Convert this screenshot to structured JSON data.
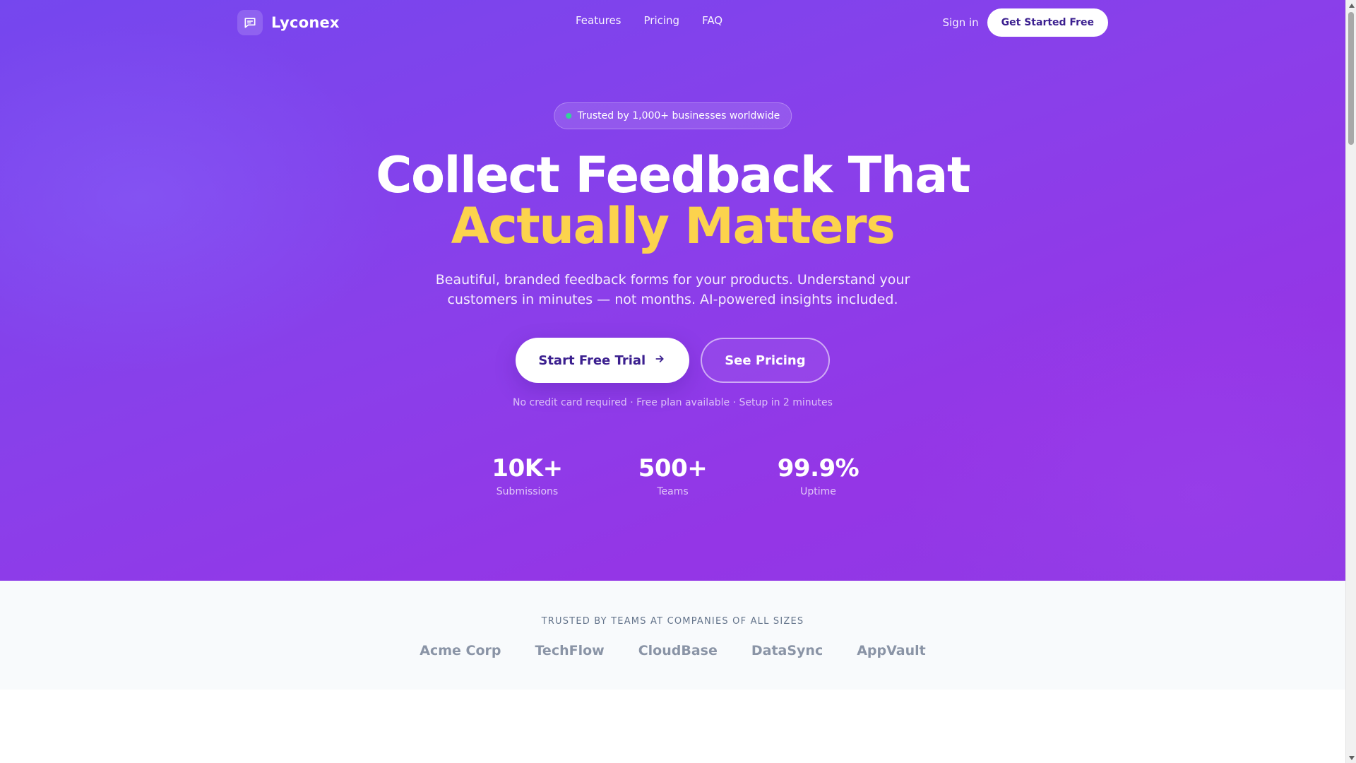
{
  "nav": {
    "brand": "Lyconex",
    "links": [
      "Features",
      "Pricing",
      "FAQ"
    ],
    "sign_in": "Sign in",
    "cta": "Get Started Free"
  },
  "hero": {
    "badge": "Trusted by 1,000+ businesses worldwide",
    "headline_line1": "Collect Feedback That",
    "headline_line2": "Actually Matters",
    "subhead": "Beautiful, branded feedback forms for your products. Understand your customers in minutes — not months. AI-powered insights included.",
    "primary_cta": "Start Free Trial",
    "secondary_cta": "See Pricing",
    "fineprint": "No credit card required · Free plan available · Setup in 2 minutes",
    "stats": [
      {
        "value": "10K+",
        "label": "Submissions"
      },
      {
        "value": "500+",
        "label": "Teams"
      },
      {
        "value": "99.9%",
        "label": "Uptime"
      }
    ]
  },
  "trusted": {
    "heading": "TRUSTED BY TEAMS AT COMPANIES OF ALL SIZES",
    "logos": [
      "Acme Corp",
      "TechFlow",
      "CloudBase",
      "DataSync",
      "AppVault"
    ]
  },
  "icons": {
    "brand": "chat-bubble-icon",
    "primary_cta": "arrow-right-icon"
  },
  "colors": {
    "hero_start": "#7547ee",
    "hero_end": "#9436e6",
    "accent_yellow": "#fcd34d",
    "badge_dot": "#34d399",
    "button_text": "#3b1f8f"
  }
}
